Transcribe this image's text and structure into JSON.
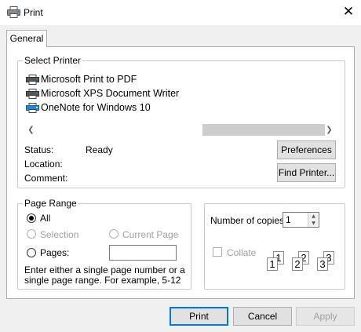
{
  "window": {
    "title": "Print",
    "close_glyph": "✕"
  },
  "tabs": [
    {
      "label": "General"
    }
  ],
  "select_printer": {
    "legend": "Select Printer",
    "printers": [
      {
        "name": "Microsoft Print to PDF",
        "icon": "printer-icon"
      },
      {
        "name": "Microsoft XPS Document Writer",
        "icon": "printer-icon"
      },
      {
        "name": "OneNote for Windows 10",
        "icon": "printer-icon"
      }
    ],
    "status_label": "Status:",
    "status_value": "Ready",
    "location_label": "Location:",
    "comment_label": "Comment:",
    "preferences_button": "Preferences",
    "find_printer_button": "Find Printer..."
  },
  "page_range": {
    "legend": "Page Range",
    "all_label": "All",
    "selection_label": "Selection",
    "current_page_label": "Current Page",
    "pages_label": "Pages:",
    "pages_value": "",
    "hint": "Enter either a single page number or a single page range.  For example, 5-12"
  },
  "copies": {
    "label": "Number of copies:",
    "value": "1",
    "collate_label": "Collate",
    "page_numbers": [
      "1",
      "1",
      "2",
      "2",
      "3",
      "3"
    ]
  },
  "footer": {
    "print": "Print",
    "cancel": "Cancel",
    "apply": "Apply"
  },
  "colors": {
    "accent": "#0078d7",
    "printer_icon_accent": "#1e88c8"
  }
}
